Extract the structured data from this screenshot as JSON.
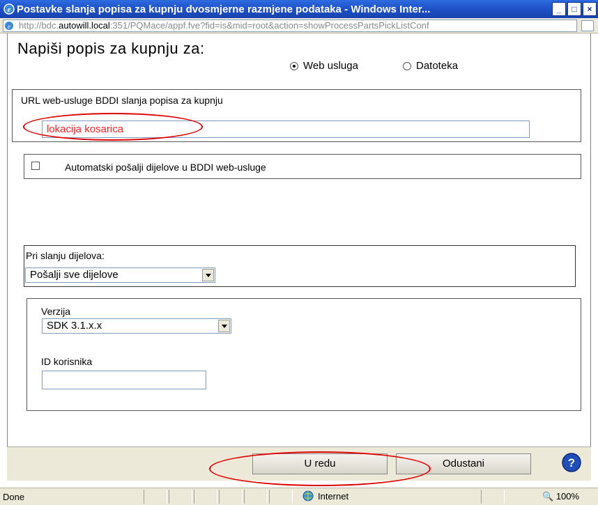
{
  "window": {
    "title": "Postavke slanja popisa za kupnju dvosmjerne razmjene podataka - Windows Inter...",
    "controls": [
      "_",
      "□",
      "×"
    ]
  },
  "address_bar": {
    "url_prefix": "http://bdc.",
    "url_host": "autowill.local",
    "url_rest": ":351/PQMace/appf.fve?fid=is&mid=root&action=showProcessPartsPickListConf"
  },
  "form": {
    "export_label": "Napiši popis za kupnju za:",
    "radios": [
      {
        "label": "Web usluga",
        "selected": true
      },
      {
        "label": "Datoteka",
        "selected": false
      }
    ],
    "url_section_label": "URL web-usluge BDDI slanja popisa za kupnju",
    "url_value": "lokacija kosarica",
    "auto_send_label": "Automatski pošalji dijelove u BDDI web-usluge",
    "auto_send_checked": false,
    "send_parts_label": "Pri slanju dijelova:",
    "send_parts_value": "Pošalji sve dijelove",
    "version_label": "Verzija",
    "version_value": "SDK 3.1.x.x",
    "user_id_label": "ID korisnika",
    "user_id_value": ""
  },
  "buttons": {
    "ok": "U redu",
    "cancel": "Odustani"
  },
  "status_bar": {
    "status": "Done",
    "zone": "Internet",
    "zoom": "100%"
  },
  "colors": {
    "title_bar": "#1d4fc4",
    "highlight": "#e00000",
    "input_text": "#ff2020"
  }
}
